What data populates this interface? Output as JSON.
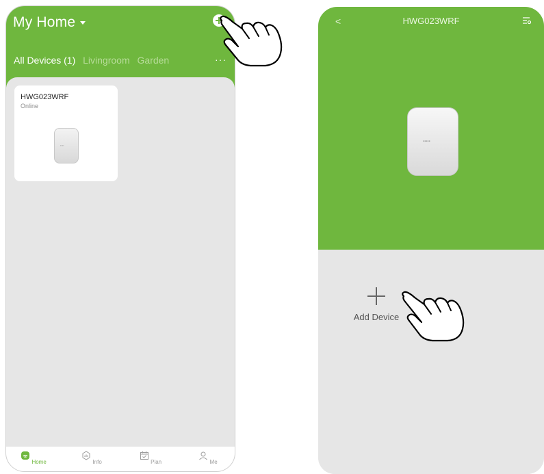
{
  "home_screen": {
    "title": "My Home",
    "tabs": [
      {
        "label": "All Devices (1)",
        "active": true
      },
      {
        "label": "Livingroom",
        "active": false
      },
      {
        "label": "Garden",
        "active": false
      }
    ],
    "more_label": "···",
    "device_card": {
      "name": "HWG023WRF",
      "status": "Online"
    },
    "bottom_nav": [
      {
        "label": "Home",
        "icon": "home-icon",
        "active": true
      },
      {
        "label": "Info",
        "icon": "info-icon",
        "active": false
      },
      {
        "label": "Plan",
        "icon": "plan-icon",
        "active": false
      },
      {
        "label": "Me",
        "icon": "user-icon",
        "active": false
      }
    ]
  },
  "device_screen": {
    "title": "HWG023WRF",
    "add_device_label": "Add Device"
  },
  "colors": {
    "accent": "#6fb73e",
    "background": "#e6e6e6"
  }
}
